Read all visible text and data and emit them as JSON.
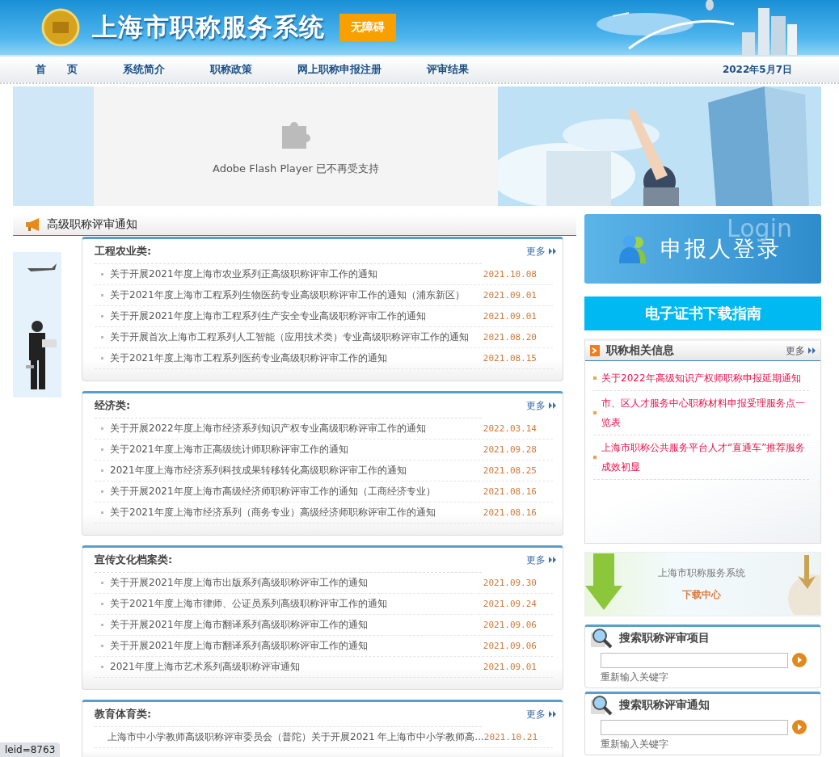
{
  "header": {
    "title": "上海市职称服务系统",
    "accessibility_button": "无障碍"
  },
  "nav": {
    "items": [
      {
        "label": "首　　页"
      },
      {
        "label": "系统简介"
      },
      {
        "label": "职称政策"
      },
      {
        "label": "网上职称申报注册"
      },
      {
        "label": "评审结果"
      }
    ],
    "date": "2022年5月7日"
  },
  "banner": {
    "flash_message": "Adobe Flash Player 已不再受支持"
  },
  "notices": {
    "title": "高级职称评审通知",
    "sections": [
      {
        "title": "工程农业类:",
        "more": "更多",
        "items": [
          {
            "text": "关于开展2021年度上海市农业系列正高级职称评审工作的通知",
            "date": "2021.10.08"
          },
          {
            "text": "关于2021年度上海市工程系列生物医药专业高级职称评审工作的通知（浦东新区）",
            "date": "2021.09.01"
          },
          {
            "text": "关于开展2021年度上海市工程系列生产安全专业高级职称评审工作的通知",
            "date": "2021.09.01"
          },
          {
            "text": "关于开展首次上海市工程系列人工智能（应用技术类）专业高级职称评审工作的通知",
            "date": "2021.08.20"
          },
          {
            "text": "关于2021年度上海市工程系列医药专业高级职称评审工作的通知",
            "date": "2021.08.15"
          }
        ]
      },
      {
        "title": "经济类:",
        "more": "更多",
        "items": [
          {
            "text": "关于开展2022年度上海市经济系列知识产权专业高级职称评审工作的通知",
            "date": "2022.03.14"
          },
          {
            "text": "关于2021年度上海市正高级统计师职称评审工作的通知",
            "date": "2021.09.28"
          },
          {
            "text": "2021年度上海市经济系列科技成果转移转化高级职称评审工作的通知",
            "date": "2021.08.25"
          },
          {
            "text": "关于开展2021年度上海市高级经济师职称评审工作的通知（工商经济专业）",
            "date": "2021.08.16"
          },
          {
            "text": "关于2021年度上海市经济系列（商务专业）高级经济师职称评审工作的通知",
            "date": "2021.08.16"
          }
        ]
      },
      {
        "title": "宣传文化档案类:",
        "more": "更多",
        "items": [
          {
            "text": "关于开展2021年度上海市出版系列高级职称评审工作的通知",
            "date": "2021.09.30"
          },
          {
            "text": "关于2021年度上海市律师、公证员系列高级职称评审工作的通知",
            "date": "2021.09.24"
          },
          {
            "text": "关于开展2021年度上海市翻译系列高级职称评审工作的通知",
            "date": "2021.09.06"
          },
          {
            "text": "关于开展2021年度上海市翻译系列高级职称评审工作的通知",
            "date": "2021.09.06"
          },
          {
            "text": "2021年度上海市艺术系列高级职称评审通知",
            "date": "2021.09.01"
          }
        ]
      },
      {
        "title": "教育体育类:",
        "more": "更多",
        "items": [
          {
            "text": "上海市中小学教师高级职称评审委员会（普陀）关于开展2021 年上海市中小学教师高...",
            "date": "2021.10.21"
          }
        ]
      }
    ]
  },
  "login": {
    "label": "申报人登录",
    "watermark": "Login"
  },
  "certificate_guide": "电子证书下载指南",
  "info": {
    "title": "职称相关信息",
    "more": "更多",
    "items": [
      {
        "text": "关于2022年高级知识产权师职称申报延期通知"
      },
      {
        "text": "市、区人才服务中心职称材料申报受理服务点一览表"
      },
      {
        "text": "上海市职称公共服务平台人才“直通车”推荐服务成效初显"
      }
    ]
  },
  "download_center": {
    "subtitle": "上海市职称服务系统",
    "title": "下载中心"
  },
  "searches": [
    {
      "title": "搜索职称评审项目",
      "reset": "重新输入关键字"
    },
    {
      "title": "搜索职称评审通知",
      "reset": "重新输入关键字"
    }
  ],
  "status_bar": "leid=8763"
}
